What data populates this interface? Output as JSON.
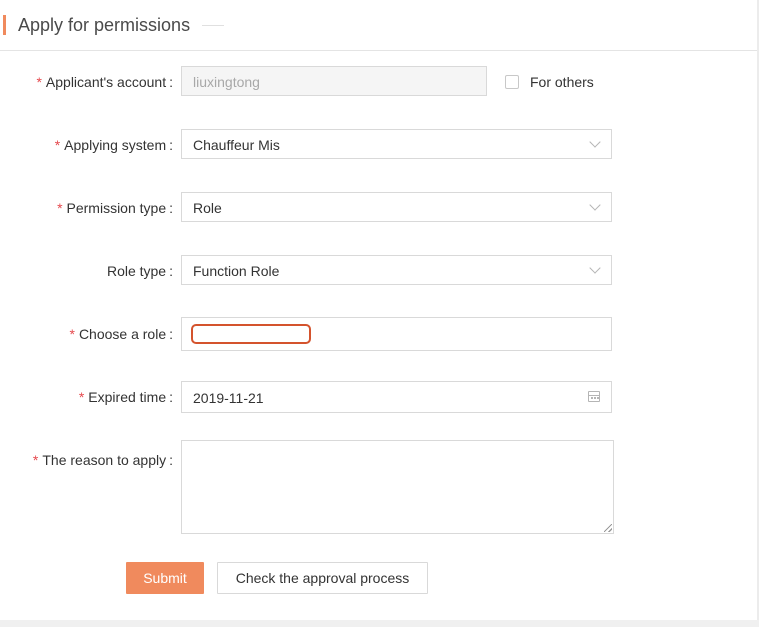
{
  "header": {
    "title": "Apply for permissions"
  },
  "form": {
    "applicant": {
      "label": "Applicant's account",
      "value": "liuxingtong",
      "required": "*"
    },
    "for_others": {
      "label": "For others",
      "checked": false
    },
    "system": {
      "label": "Applying system",
      "value": "Chauffeur Mis",
      "required": "*"
    },
    "permission_type": {
      "label": "Permission type",
      "value": "Role",
      "required": "*"
    },
    "role_type": {
      "label": "Role type",
      "value": "Function Role"
    },
    "choose_role": {
      "label": "Choose a role",
      "value": "",
      "required": "*"
    },
    "expired_time": {
      "label": "Expired time",
      "value": "2019-11-21",
      "required": "*"
    },
    "reason": {
      "label": "The reason to apply",
      "value": "",
      "required": "*"
    },
    "colon": ":"
  },
  "actions": {
    "submit_label": "Submit",
    "approval_label": "Check the approval process"
  },
  "colors": {
    "accent": "#f08a5d",
    "required": "#e5484d",
    "focus_border": "#d4532d"
  },
  "icons": {
    "dropdown": "chevron-down-icon",
    "calendar": "calendar-icon",
    "resize": "resize-grip-icon"
  }
}
